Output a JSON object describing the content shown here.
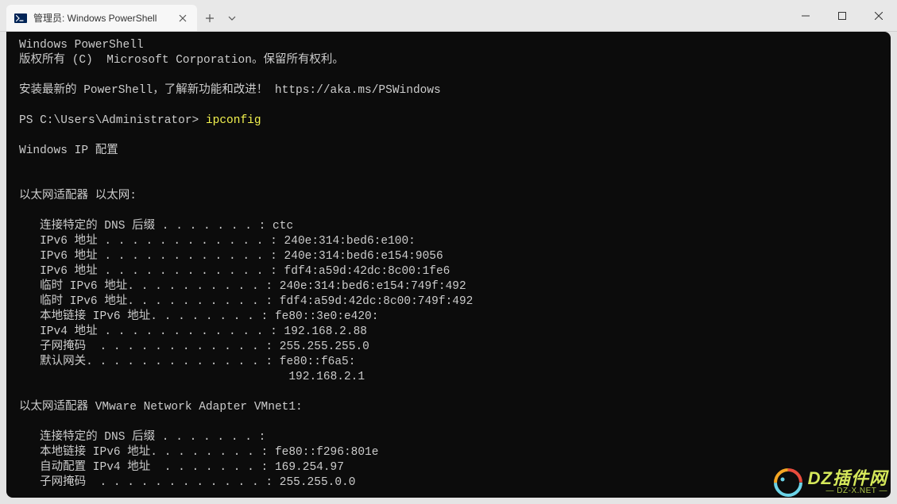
{
  "titlebar": {
    "tab": {
      "title": "管理员: Windows PowerShell"
    }
  },
  "terminal": {
    "lines": [
      "Windows PowerShell",
      "版权所有 (C)  Microsoft Corporation。保留所有权利。",
      "",
      "安装最新的 PowerShell，了解新功能和改进！ https://aka.ms/PSWindows",
      ""
    ],
    "prompt": {
      "path": "PS C:\\Users\\Administrator> ",
      "command": "ipconfig"
    },
    "output": [
      "",
      "Windows IP 配置",
      "",
      "",
      "以太网适配器 以太网:",
      "",
      "   连接特定的 DNS 后缀 . . . . . . . : ctc",
      "   IPv6 地址 . . . . . . . . . . . . : 240e:314:bed6:e100:",
      "   IPv6 地址 . . . . . . . . . . . . : 240e:314:bed6:e154:9056",
      "   IPv6 地址 . . . . . . . . . . . . : fdf4:a59d:42dc:8c00:1fe6",
      "   临时 IPv6 地址. . . . . . . . . . : 240e:314:bed6:e154:749f:492",
      "   临时 IPv6 地址. . . . . . . . . . : fdf4:a59d:42dc:8c00:749f:492",
      "   本地链接 IPv6 地址. . . . . . . . : fe80::3e0:e420:",
      "   IPv4 地址 . . . . . . . . . . . . : 192.168.2.88",
      "   子网掩码  . . . . . . . . . . . . : 255.255.255.0",
      "   默认网关. . . . . . . . . . . . . : fe80::f6a5:",
      "                                       192.168.2.1",
      "",
      "以太网适配器 VMware Network Adapter VMnet1:",
      "",
      "   连接特定的 DNS 后缀 . . . . . . . :",
      "   本地链接 IPv6 地址. . . . . . . . : fe80::f296:801e",
      "   自动配置 IPv4 地址  . . . . . . . : 169.254.97",
      "   子网掩码  . . . . . . . . . . . . : 255.255.0.0"
    ]
  },
  "watermark": {
    "main": "DZ插件网",
    "sub": "— DZ-X.NET —"
  }
}
